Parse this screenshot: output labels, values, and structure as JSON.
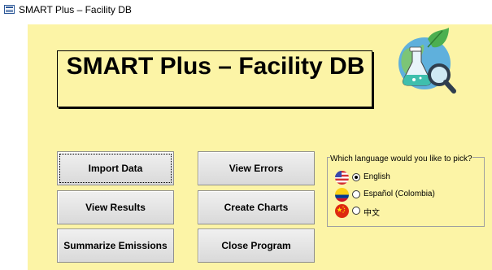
{
  "window": {
    "title": "SMART Plus – Facility DB"
  },
  "header": {
    "title": "SMART Plus – Facility DB"
  },
  "buttons": {
    "import": "Import Data",
    "errors": "View Errors",
    "results": "View Results",
    "charts": "Create Charts",
    "emissions": "Summarize Emissions",
    "close": "Close Program"
  },
  "language": {
    "prompt": "Which language would you like to pick?",
    "selected": "English",
    "options": [
      {
        "label": "English",
        "flag": "us-flag-icon"
      },
      {
        "label": "Español (Colombia)",
        "flag": "colombia-flag-icon"
      },
      {
        "label": "中文",
        "flag": "china-flag-icon"
      }
    ]
  },
  "colors": {
    "form_background": "#fcf4a6",
    "button_face": "#e6e6e6"
  }
}
